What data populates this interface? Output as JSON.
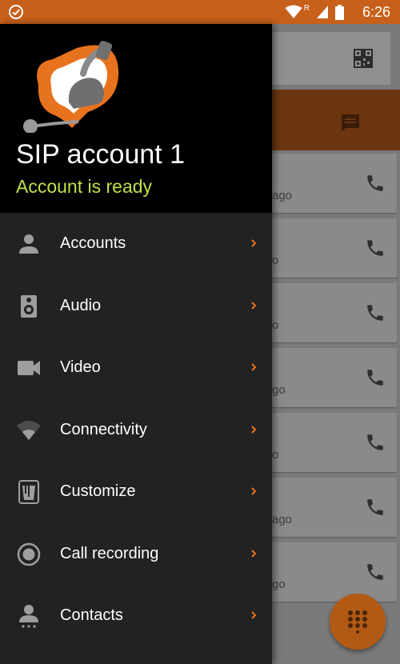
{
  "status_bar": {
    "time": "6:26",
    "network_badge": "R",
    "icons": [
      "check-circle-icon",
      "wifi-icon",
      "cell-signal-icon",
      "battery-icon"
    ]
  },
  "colors": {
    "accent": "#e8731f",
    "status_bar": "#c7601a",
    "ready_green": "#bfe04a",
    "drawer_bg": "#222222",
    "header_bg": "#000000"
  },
  "drawer": {
    "account_name": "SIP account 1",
    "account_status": "Account is ready",
    "menu_items": [
      {
        "label": "Accounts",
        "icon": "person-icon"
      },
      {
        "label": "Audio",
        "icon": "speaker-icon"
      },
      {
        "label": "Video",
        "icon": "videocam-icon"
      },
      {
        "label": "Connectivity",
        "icon": "wifi-icon"
      },
      {
        "label": "Customize",
        "icon": "paint-bucket-icon"
      },
      {
        "label": "Call recording",
        "icon": "record-icon"
      },
      {
        "label": "Contacts",
        "icon": "contact-dialpad-icon"
      }
    ]
  },
  "background_list": {
    "row_subtitles": [
      "ago",
      "o",
      "o",
      "go",
      "o",
      "ago",
      "go"
    ]
  }
}
